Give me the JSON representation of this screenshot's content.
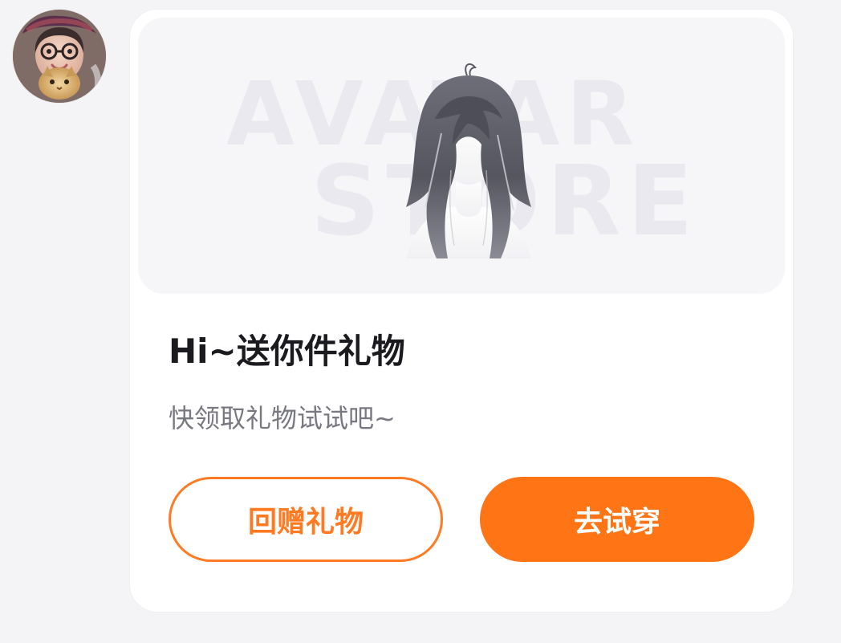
{
  "avatar_icon": "user-avatar-icon",
  "card": {
    "banner": {
      "line1": "AVATAR",
      "line2": "STORE",
      "product_icon": "hair-item-icon"
    },
    "title": "Hi~送你件礼物",
    "subtitle": "快领取礼物试试吧~",
    "buttons": {
      "secondary": "回赠礼物",
      "primary": "去试穿"
    }
  },
  "colors": {
    "accent": "#ff7415",
    "title": "#1b1b1f",
    "subtitle": "#787880",
    "page_bg": "#f4f4f6"
  }
}
